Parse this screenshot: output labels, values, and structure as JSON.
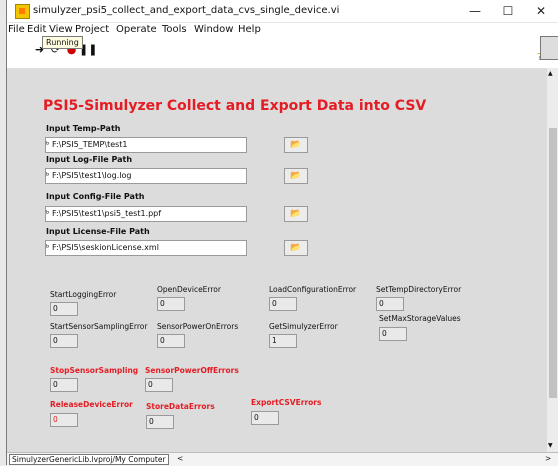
{
  "window": {
    "title": "simulyzer_psi5_collect_and_export_data_cvs_single_device.vi",
    "minimize": "—",
    "maximize": "☐",
    "close": "✕"
  },
  "menu": [
    "File",
    "Edit",
    "View",
    "Project",
    "Operate",
    "Tools",
    "Window",
    "Help"
  ],
  "toolbar": {
    "status": "Running",
    "help": "?"
  },
  "panel": {
    "title": "PSI5-Simulyzer Collect and Export Data into CSV",
    "paths": [
      {
        "label": "Input Temp-Path",
        "value": "F:\\PSI5_TEMP\\test1"
      },
      {
        "label": "Input Log-File Path",
        "value": "F:\\PSI5\\test1\\log.log"
      },
      {
        "label": "Input Config-File Path",
        "value": "F:\\PSI5\\test1\\psi5_test1.ppf"
      },
      {
        "label": "Input License-File Path",
        "value": "F:\\PSI5\\seskionLicense.xml"
      }
    ],
    "indicators": [
      {
        "label": "StartLoggingError",
        "value": "0"
      },
      {
        "label": "OpenDeviceError",
        "value": "0"
      },
      {
        "label": "LoadConfigurationError",
        "value": "0"
      },
      {
        "label": "SetTempDirectoryError",
        "value": "0"
      },
      {
        "label": "StartSensorSamplingError",
        "value": "0"
      },
      {
        "label": "SensorPowerOnErrors",
        "value": "0"
      },
      {
        "label": "GetSimulyzerError",
        "value": "1"
      },
      {
        "label": "SetMaxStorageValues",
        "value": "0"
      },
      {
        "label": "StopSensorSampling",
        "value": "0"
      },
      {
        "label": "SensorPowerOffErrors",
        "value": "0"
      },
      {
        "label": "ReleaseDeviceError",
        "value": "0"
      },
      {
        "label": "StoreDataErrors",
        "value": "0"
      },
      {
        "label": "ExportCSVErrors",
        "value": "0"
      }
    ]
  },
  "statusbar": {
    "text": "SimulyzerGenericLib.lvproj/My Computer",
    "left_arrow": "<",
    "right_arrow": ">"
  }
}
